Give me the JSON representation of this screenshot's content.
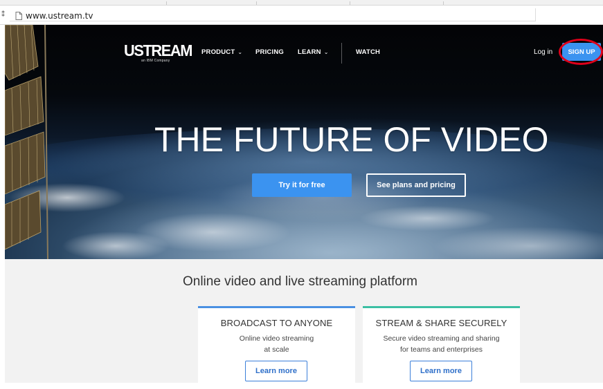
{
  "browser": {
    "url": "www.ustream.tv",
    "left_glyph": "⁑"
  },
  "nav": {
    "logo": "USTREAM",
    "logo_sub": "an IBM Company",
    "items": [
      {
        "label": "PRODUCT",
        "has_dropdown": true
      },
      {
        "label": "PRICING",
        "has_dropdown": false
      },
      {
        "label": "LEARN",
        "has_dropdown": true
      },
      {
        "label": "WATCH",
        "has_dropdown": false
      }
    ],
    "chevron": "⌄",
    "login": "Log in",
    "signup": "SIGN UP"
  },
  "hero": {
    "title": "THE FUTURE OF VIDEO",
    "primary_button": "Try it for free",
    "secondary_button": "See plans and pricing"
  },
  "section": {
    "subtitle": "Online video and live streaming platform",
    "cards": [
      {
        "title": "BROADCAST TO ANYONE",
        "desc_line1": "Online video streaming",
        "desc_line2": "at scale",
        "button": "Learn more"
      },
      {
        "title": "STREAM & SHARE SECURELY",
        "desc_line1": "Secure video streaming and sharing",
        "desc_line2": "for teams and enterprises",
        "button": "Learn more"
      }
    ]
  },
  "colors": {
    "accent_blue": "#3b93f0",
    "card1_border": "#4a90e2",
    "card2_border": "#3bbfa3",
    "annotation_ring": "#e0001a"
  }
}
